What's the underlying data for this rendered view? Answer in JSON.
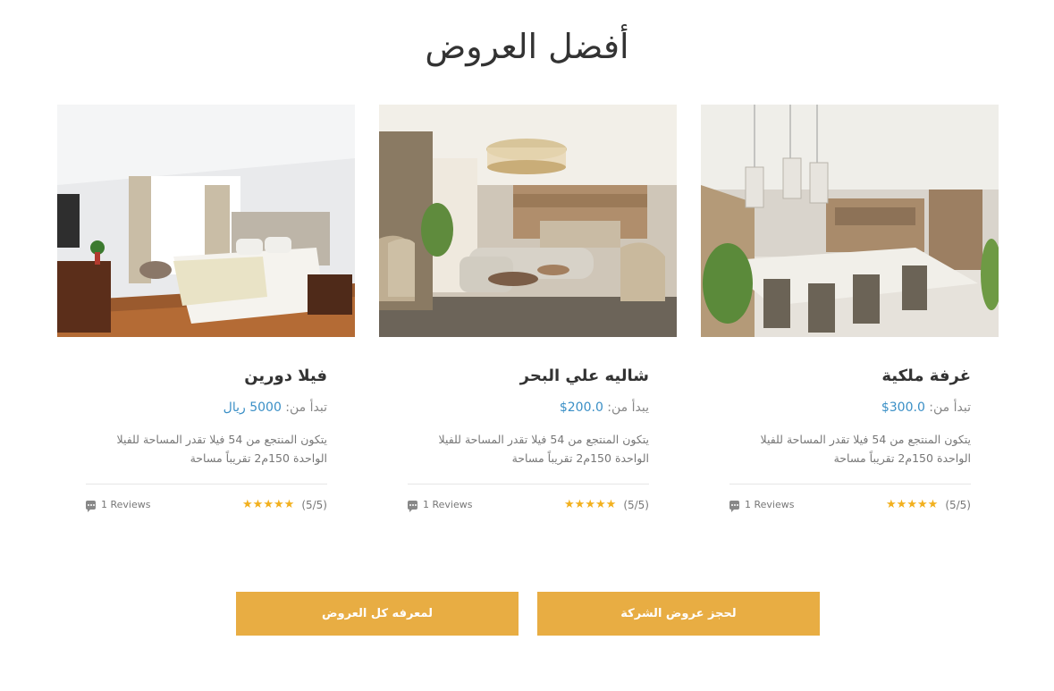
{
  "section_title": "أفضل العروض",
  "cards": [
    {
      "title": "غرفة ملكية",
      "price_label": "تبدأ من: ",
      "price_value": "300.0$",
      "description": "يتكون المنتجع من 54 فيلا تقدر المساحة للفيلا الواحدة 150م2 تقريباً مساحة",
      "reviews": "1 Reviews",
      "rating": "(5/5)",
      "stars": "★★★★★",
      "image_alt": "dining room with chandeliers"
    },
    {
      "title": "شاليه علي البحر",
      "price_label": "يبدأ من: ",
      "price_value": "200.0$",
      "description": "يتكون المنتجع من 54 فيلا تقدر المساحة للفيلا الواحدة 150م2 تقريباً مساحة",
      "reviews": "1 Reviews",
      "rating": "(5/5)",
      "stars": "★★★★★",
      "image_alt": "living room with sofas"
    },
    {
      "title": "فيلا دورين",
      "price_label": "تبدأ من: ",
      "price_value": "5000 ريال",
      "description": "يتكون المنتجع من 54 فيلا تقدر المساحة للفيلا الواحدة 150م2 تقريباً مساحة",
      "reviews": "1 Reviews",
      "rating": "(5/5)",
      "stars": "★★★★★",
      "image_alt": "bedroom with double bed"
    }
  ],
  "buttons": {
    "book_offers": "لحجز عروض الشركة",
    "all_offers": "لمعرفه كل العروض"
  },
  "colors": {
    "accent": "#e8ad43",
    "price": "#3a8fc6",
    "stars": "#f2b01e"
  }
}
